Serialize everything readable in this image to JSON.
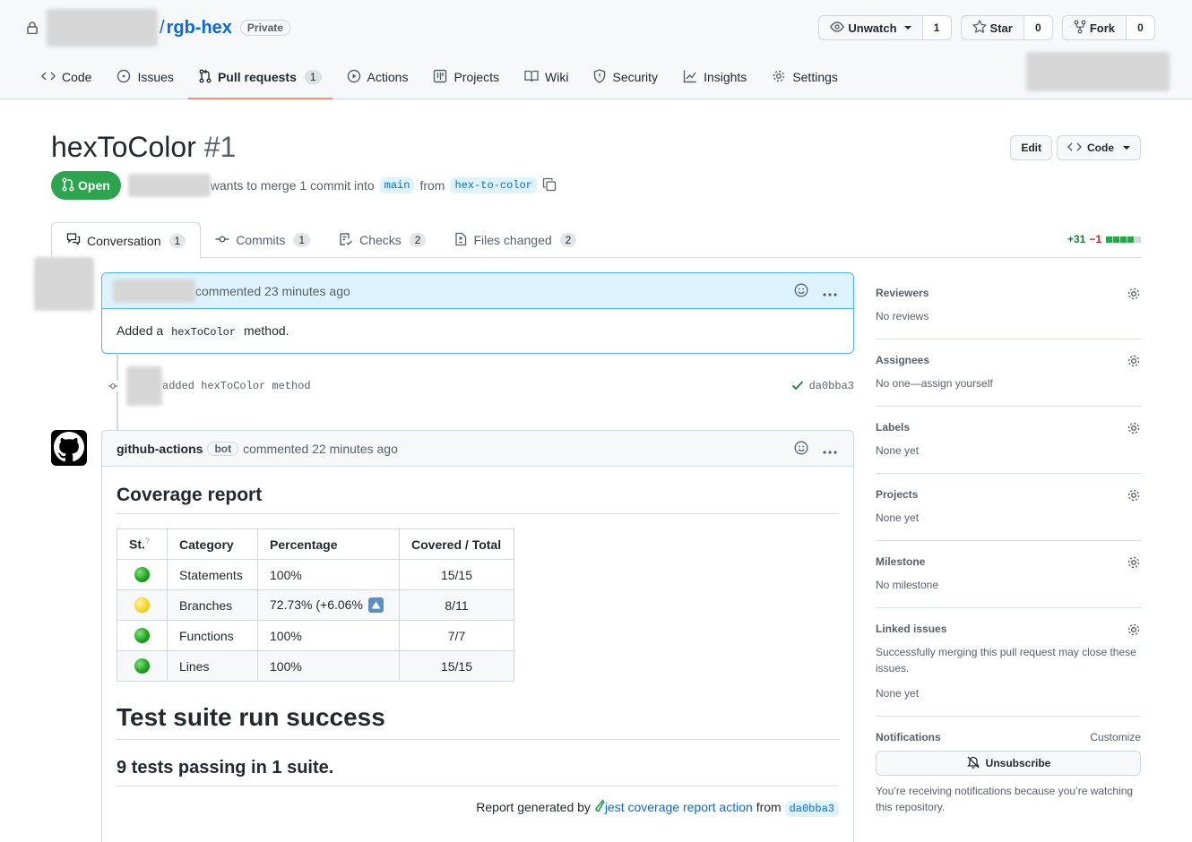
{
  "repo": {
    "name": "rgb-hex",
    "visibility": "Private",
    "watch_label": "Unwatch",
    "watch_count": "1",
    "star_label": "Star",
    "star_count": "0",
    "fork_label": "Fork",
    "fork_count": "0"
  },
  "nav": {
    "code": "Code",
    "issues": "Issues",
    "pulls": "Pull requests",
    "pulls_count": "1",
    "actions": "Actions",
    "projects": "Projects",
    "wiki": "Wiki",
    "security": "Security",
    "insights": "Insights",
    "settings": "Settings"
  },
  "pr": {
    "title": "hexToColor",
    "number": "#1",
    "edit_label": "Edit",
    "code_label": "Code",
    "state": "Open",
    "merge_text": "wants to merge 1 commit into",
    "base_branch": "main",
    "from_text": "from",
    "head_branch": "hex-to-color"
  },
  "tabs": {
    "conversation": "Conversation",
    "conversation_count": "1",
    "commits": "Commits",
    "commits_count": "1",
    "checks": "Checks",
    "checks_count": "2",
    "files": "Files changed",
    "files_count": "2",
    "additions": "+31",
    "deletions": "−1"
  },
  "comment1": {
    "meta": "commented 23 minutes ago",
    "body_pre": "Added a",
    "body_code": "hexToColor",
    "body_post": "method."
  },
  "commit": {
    "message": "added hexToColor method",
    "sha": "da0bba3"
  },
  "comment2": {
    "author": "github-actions",
    "bot": "bot",
    "meta": "commented 22 minutes ago",
    "heading": "Coverage report",
    "table": {
      "headers": [
        "St.",
        "Category",
        "Percentage",
        "Covered / Total"
      ],
      "status_help": "?",
      "rows": [
        {
          "status": "green",
          "category": "Statements",
          "percentage": "100%",
          "covered": "15/15"
        },
        {
          "status": "yellow",
          "category": "Branches",
          "percentage": "72.73% (+6.06%",
          "covered": "8/11"
        },
        {
          "status": "green",
          "category": "Functions",
          "percentage": "100%",
          "covered": "7/7"
        },
        {
          "status": "green",
          "category": "Lines",
          "percentage": "100%",
          "covered": "15/15"
        }
      ]
    },
    "suite_heading": "Test suite run success",
    "tests_heading": "9 tests passing in 1 suite.",
    "footer_pre": "Report generated by",
    "footer_link": "jest coverage report action",
    "footer_from": "from",
    "footer_sha": "da0bba3"
  },
  "sidebar": {
    "reviewers_title": "Reviewers",
    "reviewers_val": "No reviews",
    "assignees_title": "Assignees",
    "assignees_val": "No one—assign yourself",
    "labels_title": "Labels",
    "labels_val": "None yet",
    "projects_title": "Projects",
    "projects_val": "None yet",
    "milestone_title": "Milestone",
    "milestone_val": "No milestone",
    "linked_title": "Linked issues",
    "linked_desc": "Successfully merging this pull request may close these issues.",
    "linked_val": "None yet",
    "notifications_title": "Notifications",
    "customize": "Customize",
    "unsubscribe": "Unsubscribe",
    "notify_note": "You’re receiving notifications because you’re watching this repository."
  },
  "colors": {
    "accent": "#0969da",
    "open_green": "#2da44e",
    "tab_underline": "#fd8c73"
  }
}
